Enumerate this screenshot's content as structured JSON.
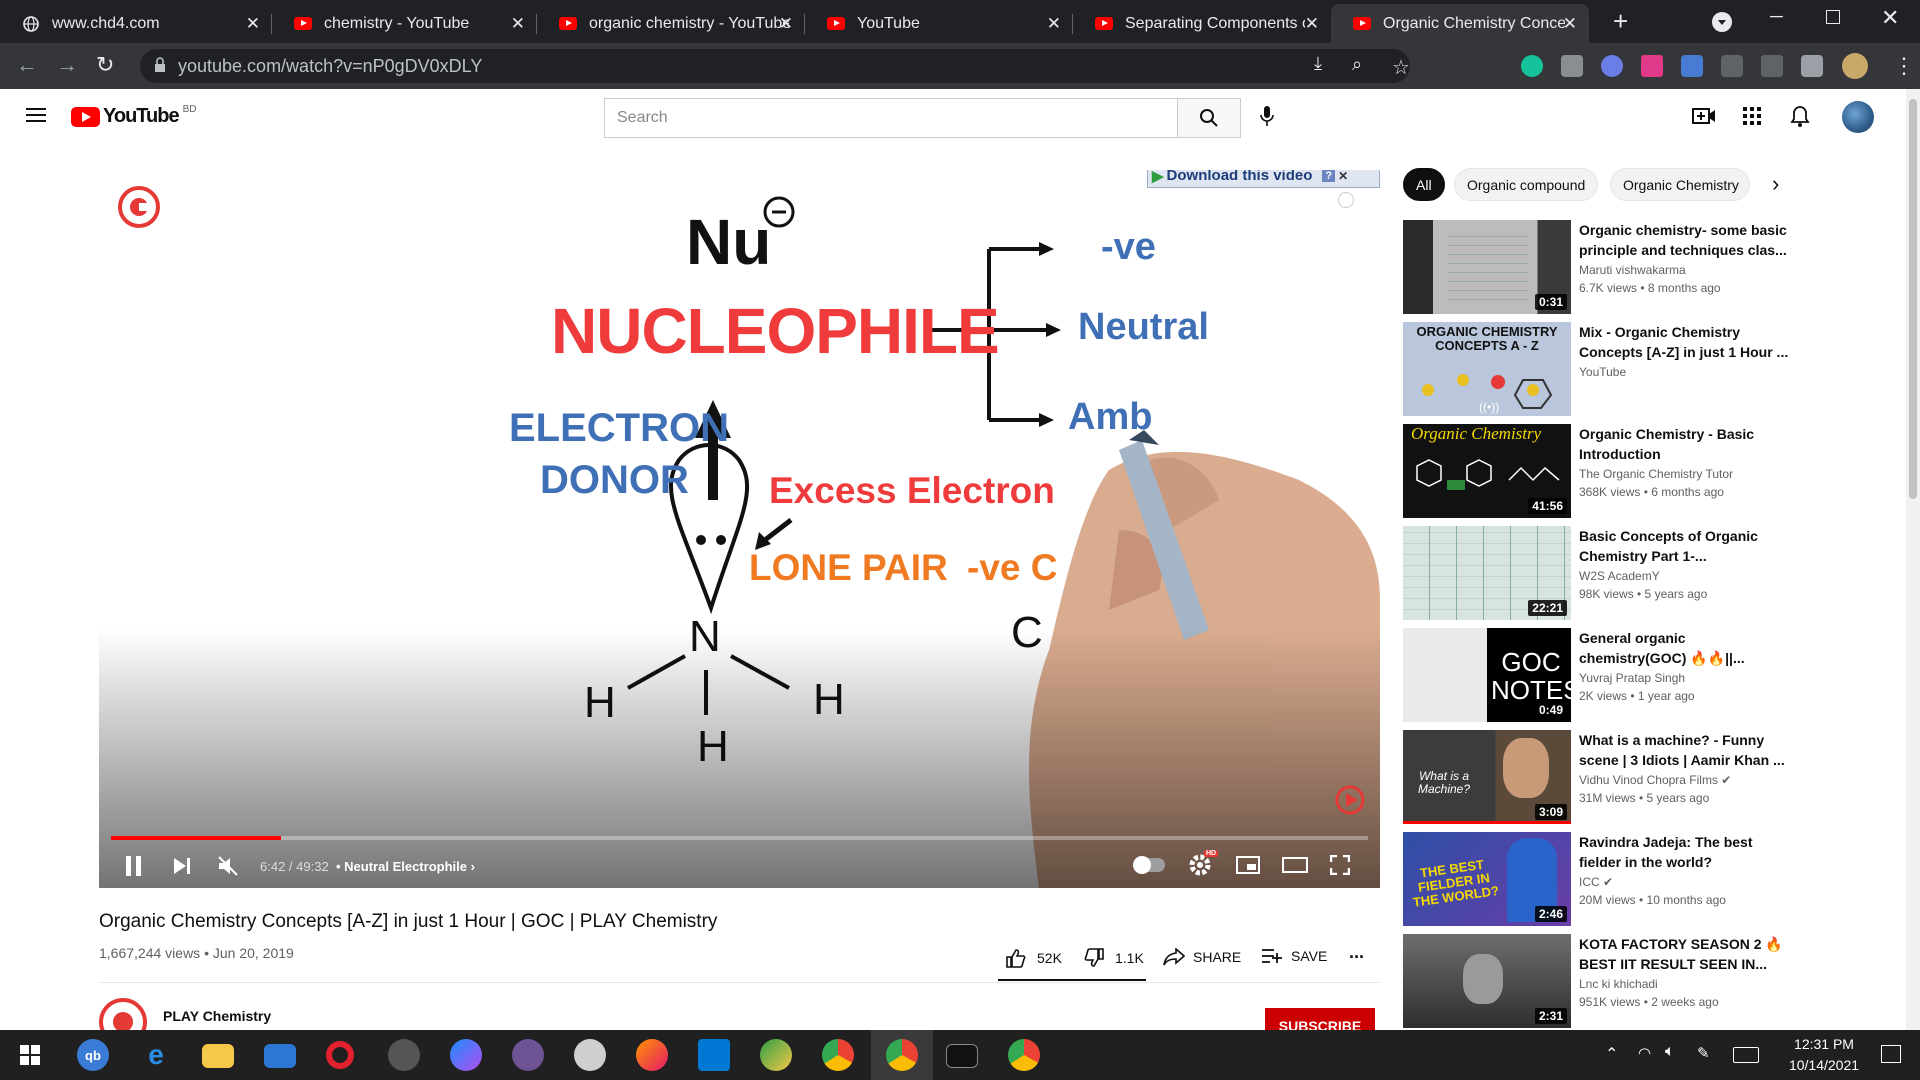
{
  "tabs": [
    {
      "title": "www.chd4.com"
    },
    {
      "title": "chemistry - YouTube"
    },
    {
      "title": "organic chemistry - YouTube"
    },
    {
      "title": "YouTube"
    },
    {
      "title": "Separating Components of"
    },
    {
      "title": "Organic Chemistry Concepts"
    }
  ],
  "address": {
    "url": "youtube.com/watch?v=nP0gDV0xDLY"
  },
  "yt": {
    "logo": "YouTube",
    "region": "BD",
    "search_placeholder": "Search"
  },
  "video_frame": {
    "download_banner": "Download this video",
    "nu": "Nu",
    "nucleophile": "NUCLEOPHILE",
    "branch1": "-ve",
    "branch2": "Neutral",
    "branch3": "Amb",
    "electron_donor_1": "ELECTRON",
    "electron_donor_2": "DONOR",
    "excess": "Excess Electron",
    "lone_pair": "LONE PAIR",
    "ve_c": "-ve C",
    "n": "N",
    "h1": "H",
    "h2": "H",
    "h3": "H",
    "c_partial": "C"
  },
  "player": {
    "time": "6:42 / 49:32",
    "chapter": "• Neutral Electrophile",
    "hd": "HD",
    "progress_fraction": 0.135
  },
  "video": {
    "title": "Organic Chemistry Concepts [A-Z] in just 1 Hour | GOC | PLAY Chemistry",
    "views_date": "1,667,244 views • Jun 20, 2019",
    "likes": "52K",
    "dislikes": "1.1K",
    "share": "SHARE",
    "save": "SAVE",
    "more": "...",
    "channel": "PLAY Chemistry",
    "subscribe": "SUBSCRIBE"
  },
  "chips": [
    "All",
    "Organic compound",
    "Organic Chemistry"
  ],
  "related": [
    {
      "title": "Organic chemistry- some basic principle and techniques clas...",
      "channel": "Maruti vishwakarma",
      "meta": "6.7K views • 8 months ago",
      "duration": "0:31",
      "thumb_text": ""
    },
    {
      "title": "Mix - Organic Chemistry Concepts [A-Z] in just 1 Hour ...",
      "channel": "YouTube",
      "meta": "",
      "duration": "",
      "thumb_text": "ORGANIC CHEMISTRY CONCEPTS A - Z"
    },
    {
      "title": "Organic Chemistry - Basic Introduction",
      "channel": "The Organic Chemistry Tutor",
      "meta": "368K views • 6 months ago",
      "duration": "41:56",
      "thumb_text": "Organic Chemistry"
    },
    {
      "title": "Basic Concepts of Organic Chemistry Part 1-...",
      "channel": "W2S AcademY",
      "meta": "98K views • 5 years ago",
      "duration": "22:21",
      "thumb_text": ""
    },
    {
      "title": "General organic chemistry(GOC) 🔥🔥||...",
      "channel": "Yuvraj Pratap Singh",
      "meta": "2K views • 1 year ago",
      "duration": "0:49",
      "thumb_text": "GOC NOTES"
    },
    {
      "title": "What is a machine? - Funny scene | 3 Idiots | Aamir Khan ...",
      "channel": "Vidhu Vinod Chopra Films ✔",
      "meta": "31M views • 5 years ago",
      "duration": "3:09",
      "thumb_text": "What is a Machine?"
    },
    {
      "title": "Ravindra Jadeja: The best fielder in the world?",
      "channel": "ICC ✔",
      "meta": "20M views • 10 months ago",
      "duration": "2:46",
      "thumb_text": "THE BEST FIELDER IN THE WORLD?"
    },
    {
      "title": "KOTA FACTORY SEASON 2 🔥 BEST IIT RESULT SEEN IN...",
      "channel": "Lnc ki khichadi",
      "meta": "951K views • 2 weeks ago",
      "duration": "2:31",
      "thumb_text": ""
    }
  ],
  "taskbar": {
    "time": "12:31 PM",
    "date": "10/14/2021"
  },
  "colors": {
    "yt_red": "#ff0000",
    "frame_red": "#ef3b3b",
    "frame_blue": "#3f6fb5",
    "frame_orange": "#ef7a22"
  }
}
